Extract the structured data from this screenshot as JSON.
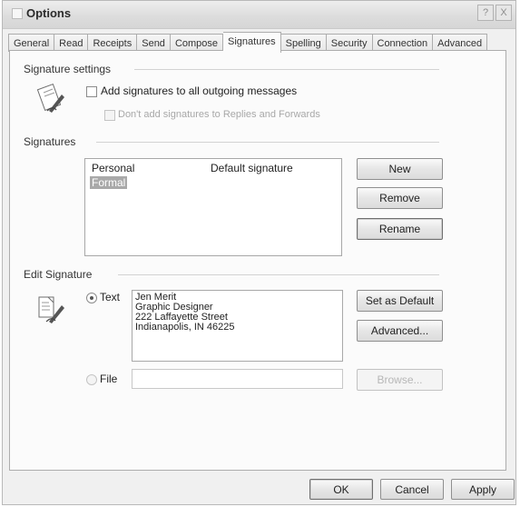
{
  "window": {
    "title": "Options",
    "help": "?",
    "close": "X"
  },
  "tabs": [
    {
      "label": "General"
    },
    {
      "label": "Read"
    },
    {
      "label": "Receipts"
    },
    {
      "label": "Send"
    },
    {
      "label": "Compose"
    },
    {
      "label": "Signatures",
      "active": true
    },
    {
      "label": "Spelling"
    },
    {
      "label": "Security"
    },
    {
      "label": "Connection"
    },
    {
      "label": "Advanced"
    }
  ],
  "signature_settings": {
    "heading": "Signature settings",
    "add_all_label": "Add signatures to all outgoing messages",
    "dont_add_label": "Don't add signatures to Replies and Forwards"
  },
  "signatures": {
    "heading": "Signatures",
    "items": [
      {
        "name": "Personal",
        "note": "Default signature"
      },
      {
        "name": "Formal"
      }
    ],
    "new_button": "New",
    "remove_button": "Remove",
    "rename_button": "Rename"
  },
  "edit_signature": {
    "heading": "Edit Signature",
    "text_label": "Text",
    "file_label": "File",
    "text_lines": [
      "Jen Merit",
      "Graphic Designer",
      "222 Laffayette Street",
      "Indianapolis, IN 46225"
    ],
    "set_default_button": "Set as Default",
    "advanced_button": "Advanced...",
    "browse_button": "Browse..."
  },
  "footer": {
    "ok": "OK",
    "cancel": "Cancel",
    "apply": "Apply"
  }
}
